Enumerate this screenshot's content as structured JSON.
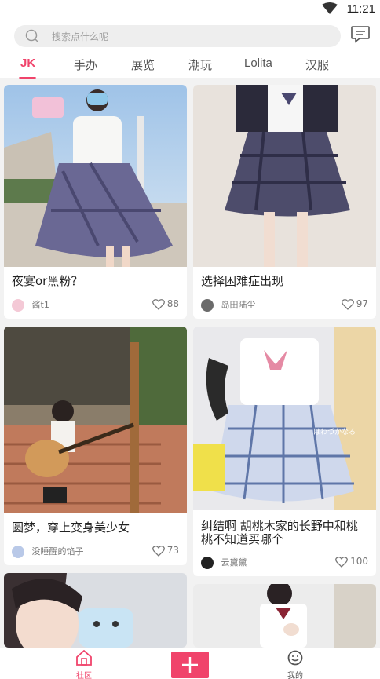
{
  "status_bar": {
    "time": "11:21"
  },
  "header": {
    "search_placeholder": "搜索点什么呢",
    "tabs": [
      {
        "label": "JK",
        "active": true
      },
      {
        "label": "手办"
      },
      {
        "label": "展览"
      },
      {
        "label": "潮玩"
      },
      {
        "label": "Lolita"
      },
      {
        "label": "汉服"
      }
    ]
  },
  "feed": [
    {
      "title": "夜宴or黑粉？",
      "author": "酱t1",
      "likes": "88"
    },
    {
      "title": "选择困难症出现",
      "author": "岛田陆尘",
      "likes": "97"
    },
    {
      "title": "圆梦，穿上变身美少女",
      "author": "没睡醒的馅子",
      "likes": "73"
    },
    {
      "title": "纠结啊  胡桃木家的长野中和桃桃不知道买哪个",
      "author": "云黛黛",
      "likes": "100",
      "photo_text": "はわづかなる"
    }
  ],
  "bottom_nav": {
    "community_label": "社区",
    "mine_label": "我的"
  },
  "colors": {
    "accent": "#f0446b",
    "background": "#f2f2f2"
  }
}
